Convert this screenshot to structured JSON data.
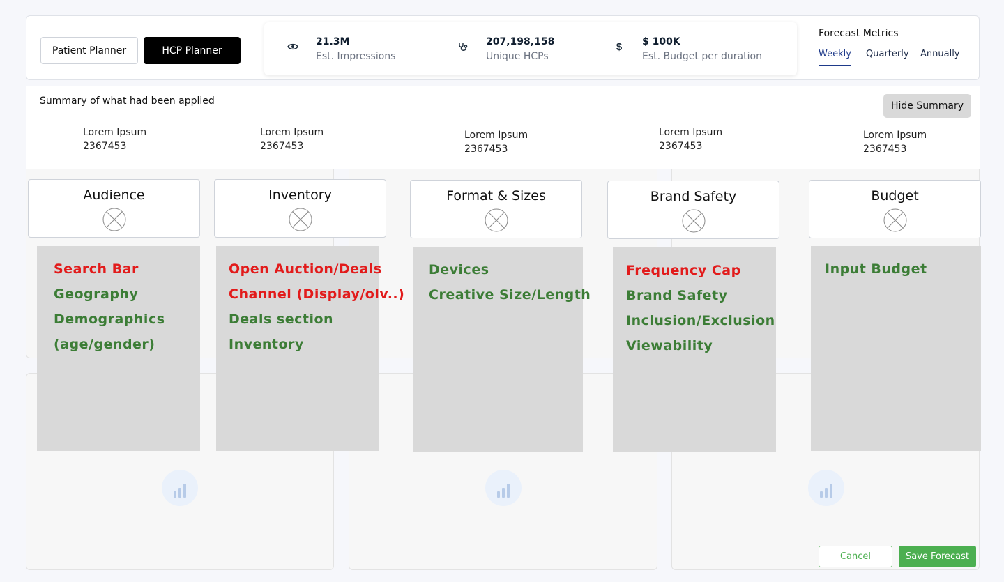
{
  "header": {
    "planners": [
      "Patient Planner",
      "HCP Planner"
    ],
    "active_planner": "HCP Planner",
    "metrics": [
      {
        "icon": "eye-icon",
        "value": "21.3M",
        "label": "Est. Impressions"
      },
      {
        "icon": "stethoscope-icon",
        "value": "207,198,158",
        "label": "Unique HCPs"
      },
      {
        "icon": "dollar-icon",
        "value": "$ 100K",
        "label": "Est. Budget per duration"
      }
    ],
    "forecast_title": "Forecast Metrics",
    "forecast_tabs": [
      "Weekly",
      "Quarterly",
      "Annually"
    ],
    "active_tab": "Weekly"
  },
  "summary": {
    "title": "Summary of what had been applied",
    "hide_label": "Hide Summary",
    "items": [
      {
        "label": "Lorem Ipsum",
        "value": "2367453"
      },
      {
        "label": "Lorem Ipsum",
        "value": "2367453"
      },
      {
        "label": "Lorem Ipsum",
        "value": "2367453"
      },
      {
        "label": "Lorem Ipsum",
        "value": "2367453"
      },
      {
        "label": "Lorem Ipsum",
        "value": "2367453"
      }
    ]
  },
  "categories": [
    {
      "title": "Audience",
      "options": [
        {
          "text": "Search Bar",
          "status": "red"
        },
        {
          "text": "Geography",
          "status": "green"
        },
        {
          "text": "Demographics",
          "status": "green"
        },
        {
          "text": "(age/gender)",
          "status": "green"
        }
      ]
    },
    {
      "title": "Inventory",
      "options": [
        {
          "text": "Open Auction/Deals",
          "status": "red"
        },
        {
          "text": "Channel (Display/olv..)",
          "status": "red"
        },
        {
          "text": "Deals section",
          "status": "green"
        },
        {
          "text": "Inventory",
          "status": "green"
        }
      ]
    },
    {
      "title": "Format & Sizes",
      "options": [
        {
          "text": "Devices",
          "status": "green"
        },
        {
          "text": "Creative Size/Length",
          "status": "green"
        }
      ]
    },
    {
      "title": "Brand Safety",
      "options": [
        {
          "text": "Frequency Cap",
          "status": "red"
        },
        {
          "text": "Brand Safety",
          "status": "green"
        },
        {
          "text": "Inclusion/Exclusion",
          "status": "green"
        },
        {
          "text": "Viewability",
          "status": "green"
        }
      ]
    },
    {
      "title": "Budget",
      "options": [
        {
          "text": "Input Budget",
          "status": "green"
        }
      ]
    }
  ],
  "colors": {
    "red": "#e21b1b",
    "green": "#3c7d36",
    "save": "#4caf50",
    "accent": "#1e3a8a"
  },
  "footer": {
    "cancel_label": "Cancel",
    "save_label": "Save Forecast"
  }
}
